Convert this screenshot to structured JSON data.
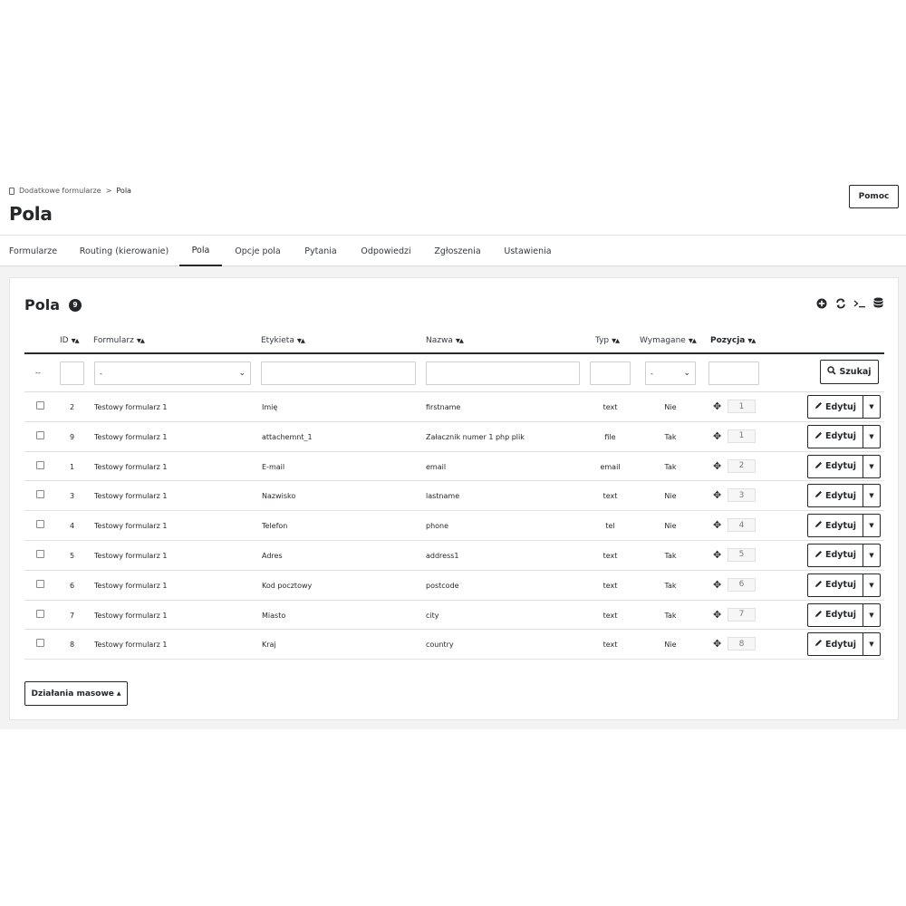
{
  "breadcrumb": {
    "parent": "Dodatkowe formularze",
    "separator": ">",
    "current": "Pola"
  },
  "page": {
    "title": "Pola",
    "help_label": "Pomoc"
  },
  "tabs": [
    {
      "label": "Formularze"
    },
    {
      "label": "Routing (kierowanie)"
    },
    {
      "label": "Pola",
      "active": true
    },
    {
      "label": "Opcje pola"
    },
    {
      "label": "Pytania"
    },
    {
      "label": "Odpowiedzi"
    },
    {
      "label": "Zgłoszenia"
    },
    {
      "label": "Ustawienia"
    }
  ],
  "panel": {
    "title": "Pola",
    "count": "9",
    "tools": [
      "plus-circle-icon",
      "refresh-icon",
      "terminal-icon",
      "database-icon"
    ]
  },
  "table": {
    "columns": {
      "id": "ID",
      "form": "Formularz",
      "label": "Etykieta",
      "name": "Nazwa",
      "type": "Typ",
      "required": "Wymagane",
      "position": "Pozycja"
    },
    "filters": {
      "placeholder_dashes": "--",
      "form_select": "-",
      "required_select": "-",
      "search_label": "Szukaj"
    },
    "rows": [
      {
        "id": "2",
        "form": "Testowy formularz 1",
        "label": "Imię",
        "name": "firstname",
        "type": "text",
        "required": "Nie",
        "position": "1"
      },
      {
        "id": "9",
        "form": "Testowy formularz 1",
        "label": "attachemnt_1",
        "name": "Załacznik numer 1 php plik",
        "type": "file",
        "required": "Tak",
        "position": "1"
      },
      {
        "id": "1",
        "form": "Testowy formularz 1",
        "label": "E-mail",
        "name": "email",
        "type": "email",
        "required": "Tak",
        "position": "2"
      },
      {
        "id": "3",
        "form": "Testowy formularz 1",
        "label": "Nazwisko",
        "name": "lastname",
        "type": "text",
        "required": "Nie",
        "position": "3"
      },
      {
        "id": "4",
        "form": "Testowy formularz 1",
        "label": "Telefon",
        "name": "phone",
        "type": "tel",
        "required": "Nie",
        "position": "4"
      },
      {
        "id": "5",
        "form": "Testowy formularz 1",
        "label": "Adres",
        "name": "address1",
        "type": "text",
        "required": "Tak",
        "position": "5"
      },
      {
        "id": "6",
        "form": "Testowy formularz 1",
        "label": "Kod pocztowy",
        "name": "postcode",
        "type": "text",
        "required": "Tak",
        "position": "6"
      },
      {
        "id": "7",
        "form": "Testowy formularz 1",
        "label": "Miasto",
        "name": "city",
        "type": "text",
        "required": "Tak",
        "position": "7"
      },
      {
        "id": "8",
        "form": "Testowy formularz 1",
        "label": "Kraj",
        "name": "country",
        "type": "text",
        "required": "Nie",
        "position": "8"
      }
    ],
    "row_action_label": "Edytuj"
  },
  "bulk_actions_label": "Działania masowe"
}
